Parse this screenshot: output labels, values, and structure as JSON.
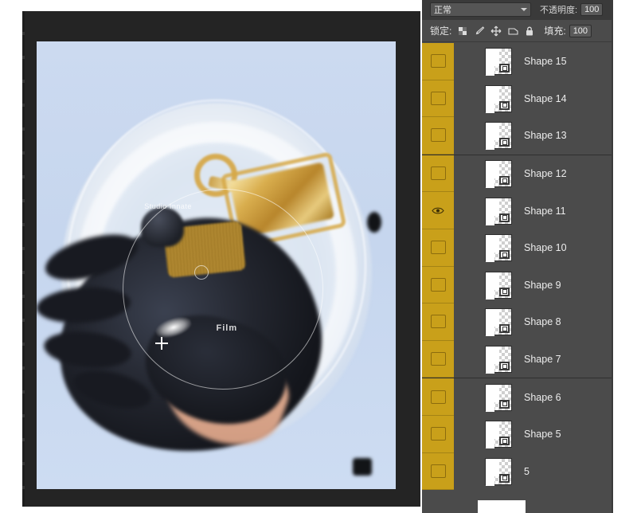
{
  "app": {
    "name": "Photoshop Layers Panel",
    "panel_bg": "#4b4b4b",
    "highlight_color": "#c9a01a"
  },
  "options_bar": {
    "blend_mode_label": "正常",
    "blend_mode_icon": "chevron-down-icon",
    "opacity_label": "不透明度:",
    "opacity_value": "100"
  },
  "lock_bar": {
    "lock_label": "锁定:",
    "lock_icons": [
      "transparent-pixels-icon",
      "brush-icon",
      "move-icon",
      "artboard-nesting-icon",
      "lock-all-icon"
    ],
    "fill_label": "填充:",
    "fill_value": "100"
  },
  "layers": [
    {
      "name": "Shape 15",
      "visible": false,
      "separator_above": false
    },
    {
      "name": "Shape 14",
      "visible": false,
      "separator_above": false
    },
    {
      "name": "Shape 13",
      "visible": false,
      "separator_above": false
    },
    {
      "name": "Shape 12",
      "visible": false,
      "separator_above": true
    },
    {
      "name": "Shape 11",
      "visible": true,
      "separator_above": false
    },
    {
      "name": "Shape 10",
      "visible": false,
      "separator_above": false
    },
    {
      "name": "Shape 9",
      "visible": false,
      "separator_above": false
    },
    {
      "name": "Shape 8",
      "visible": false,
      "separator_above": false
    },
    {
      "name": "Shape 7",
      "visible": false,
      "separator_above": false
    },
    {
      "name": "Shape 6",
      "visible": false,
      "separator_above": true
    },
    {
      "name": "Shape 5",
      "visible": false,
      "separator_above": false
    },
    {
      "name": "5",
      "visible": false,
      "separator_above": false
    }
  ],
  "canvas": {
    "document_title": "",
    "watermark_top": "Studio Innate",
    "watermark_bottom": "Film",
    "background_color": "#c8d7ee",
    "frame_color": "#242424"
  }
}
